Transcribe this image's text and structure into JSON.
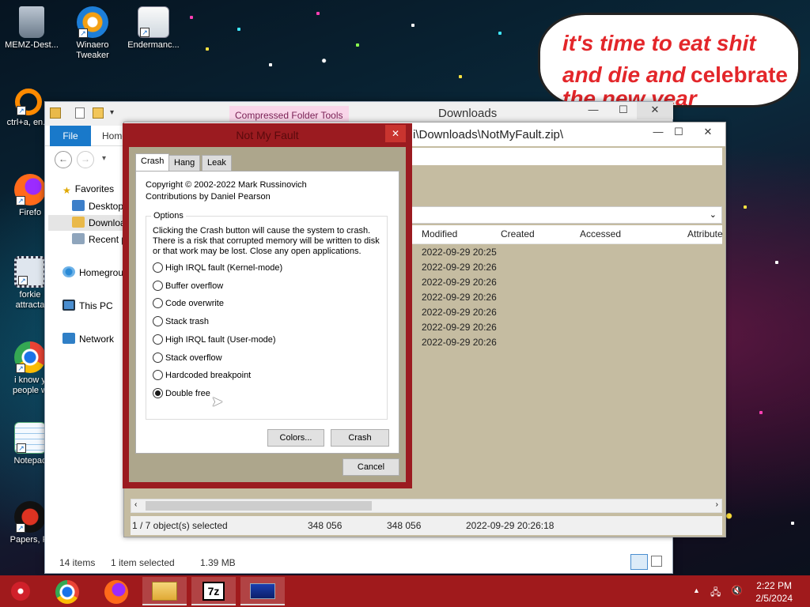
{
  "desktop": {
    "icons": [
      {
        "label": "MEMZ-Dest...",
        "icon": "recycle-bin-icon"
      },
      {
        "label": "Winaero\nTweaker",
        "icon": "winaero-icon"
      },
      {
        "label": "Endermanc...",
        "icon": "document-icon"
      },
      {
        "label": "ctrl+a, en...",
        "icon": "orange-ring-icon"
      },
      {
        "label": "Firefo",
        "icon": "firefox-icon"
      },
      {
        "label": "forkie\nattracta",
        "icon": "gear-app-icon"
      },
      {
        "label": "i know y\npeople w",
        "icon": "chrome-icon"
      },
      {
        "label": "Notepac",
        "icon": "notepad-icon"
      },
      {
        "label": "Papers, Pl",
        "icon": "papers-icon"
      }
    ]
  },
  "bubble": {
    "line1": "it's time to eat shit",
    "line2a": "and die and",
    "line2b": "celebrate",
    "line3": "the new year"
  },
  "explorer": {
    "title": "Downloads",
    "compressed_tools": "Compressed Folder Tools",
    "file_tab": "File",
    "home_tab": "Home",
    "nav": {
      "favorites": "Favorites",
      "desktop": "Desktop",
      "downloads": "Downloa",
      "recent": "Recent p",
      "homegroup": "Homegrou",
      "thispc": "This PC",
      "network": "Network"
    },
    "status_items": "14 items",
    "status_selected": "1 item selected",
    "status_size": "1.39 MB"
  },
  "zipwin": {
    "path": "i\\Downloads\\NotMyFault.zip\\",
    "columns": [
      "Modified",
      "Created",
      "Accessed",
      "Attribute"
    ],
    "rows": [
      "2022-09-29 20:25",
      "2022-09-29 20:26",
      "2022-09-29 20:26",
      "2022-09-29 20:26",
      "2022-09-29 20:26",
      "2022-09-29 20:26",
      "2022-09-29 20:26"
    ],
    "status": {
      "selected": "1 / 7 object(s) selected",
      "size1": "348 056",
      "size2": "348 056",
      "date": "2022-09-29 20:26:18"
    }
  },
  "nmf": {
    "title": "Not My Fault",
    "tabs": [
      "Crash",
      "Hang",
      "Leak"
    ],
    "copyright_line1": "Copyright © 2002-2022 Mark Russinovich",
    "copyright_line2": "Contributions by Daniel Pearson",
    "options_label": "Options",
    "description": "Clicking the Crash button will cause the system to crash. There is a risk that corrupted memory will be written to disk or that work may be lost. Close any open applications.",
    "options": [
      "High IRQL fault (Kernel-mode)",
      "Buffer overflow",
      "Code overwrite",
      "Stack trash",
      "High IRQL fault (User-mode)",
      "Stack overflow",
      "Hardcoded breakpoint",
      "Double free"
    ],
    "selected_option": "Double free",
    "colors_button": "Colors...",
    "crash_button": "Crash",
    "cancel_button": "Cancel"
  },
  "taskbar": {
    "time": "2:22 PM",
    "date": "2/5/2024",
    "apps": [
      "start-icon",
      "chrome-icon",
      "firefox-icon",
      "file-explorer-icon",
      "7zip-icon",
      "notmyfault-icon"
    ],
    "sevenzip_label": "7z"
  },
  "colors": {
    "taskbar": "#a01a1c",
    "dialog_frame": "#9b1b20",
    "dialog_client": "#ada68c",
    "explorer_accent": "#1979ca",
    "bubble_text": "#e3262a"
  }
}
